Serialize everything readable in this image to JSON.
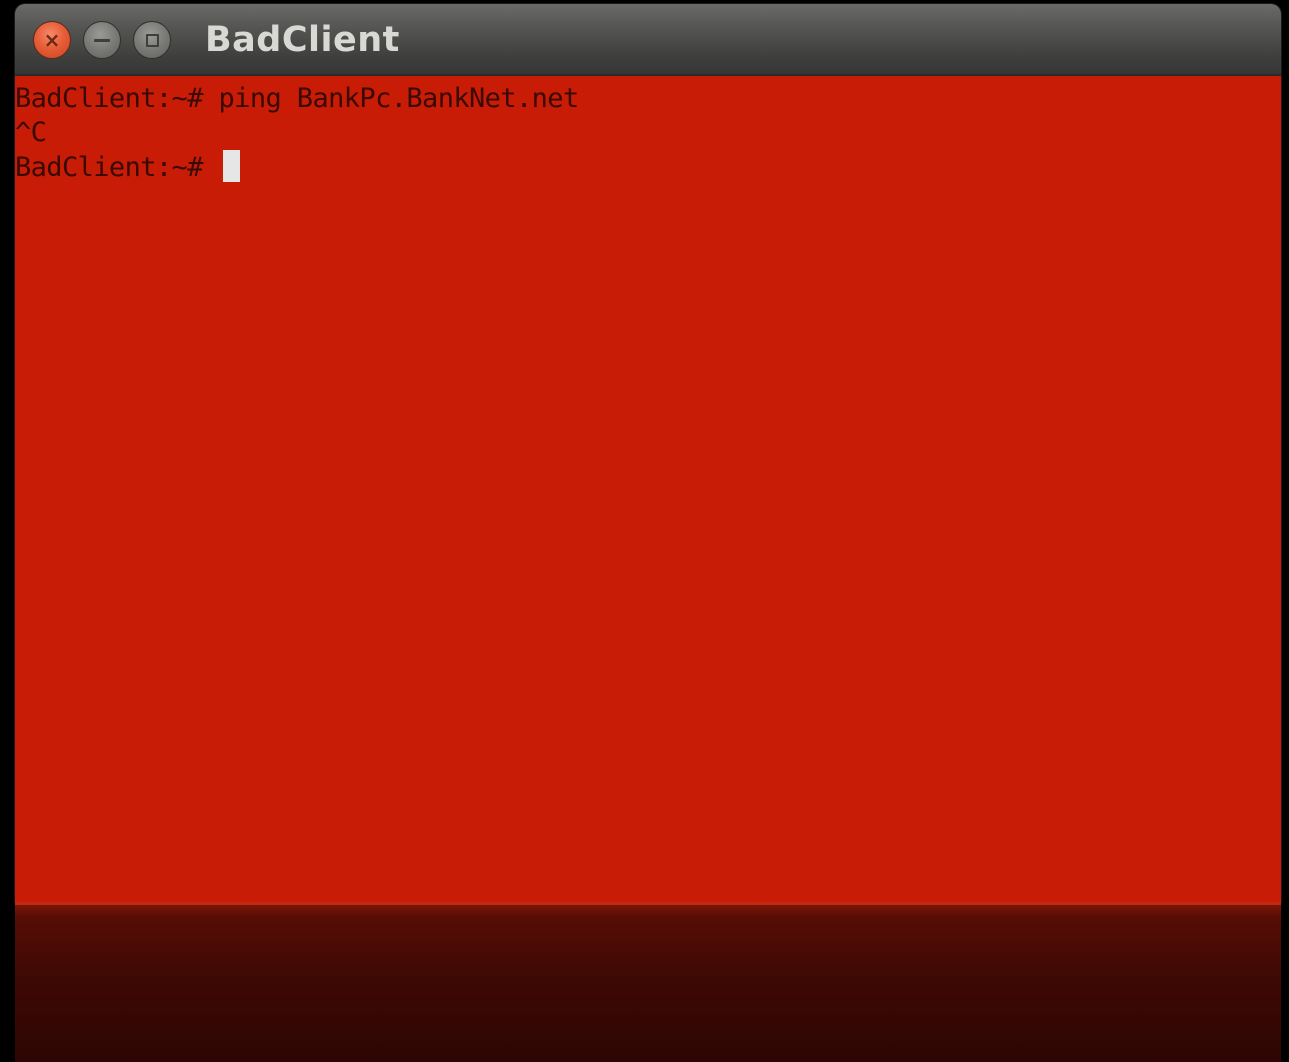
{
  "window": {
    "title": "BadClient",
    "controls": {
      "close_glyph": "×"
    }
  },
  "terminal": {
    "background_color": "#c81c06",
    "text_color": "#3a0a04",
    "lines": [
      "BadClient:~# ping BankPc.BankNet.net",
      "^C"
    ],
    "current_prompt": "BadClient:~# "
  }
}
